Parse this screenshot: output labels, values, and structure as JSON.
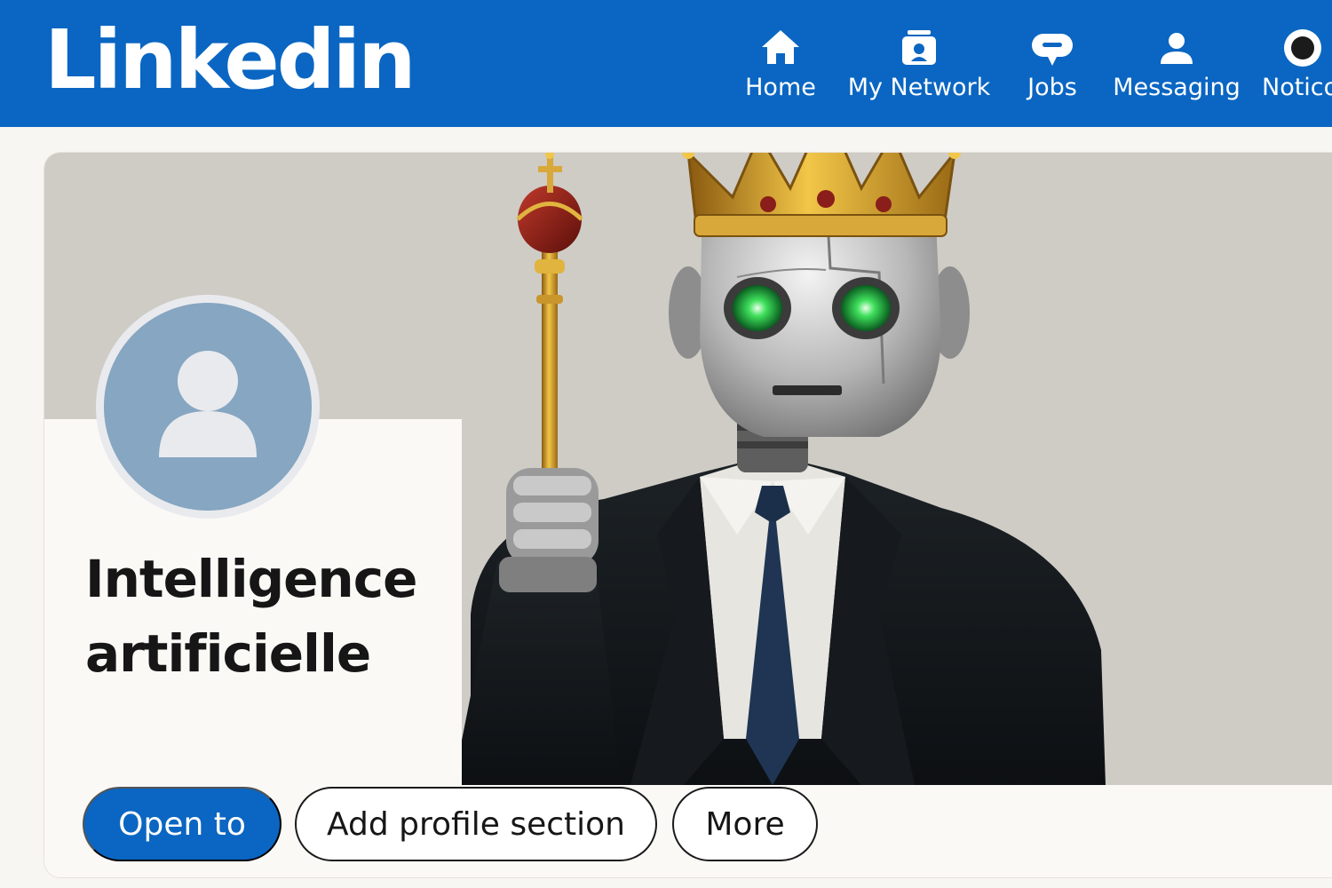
{
  "header": {
    "logo_text": "Linkedin",
    "nav": [
      {
        "label": "Home",
        "icon": "home-icon"
      },
      {
        "label": "My Network",
        "icon": "network-icon"
      },
      {
        "label": "Jobs",
        "icon": "jobs-icon"
      },
      {
        "label": "Messaging",
        "icon": "messaging-icon"
      },
      {
        "label": "Notico",
        "icon": "notifications-icon"
      }
    ]
  },
  "profile": {
    "name_line1": "Intelligence",
    "name_line2": "artificielle",
    "banner_image": "robot wearing a golden crown holding a scepter, in a dark suit"
  },
  "actions": {
    "open_to": "Open to",
    "add_section": "Add profile section",
    "more": "More"
  },
  "colors": {
    "brand": "#0a66c2",
    "avatar_bg": "#86a6c1",
    "text": "#161616"
  }
}
